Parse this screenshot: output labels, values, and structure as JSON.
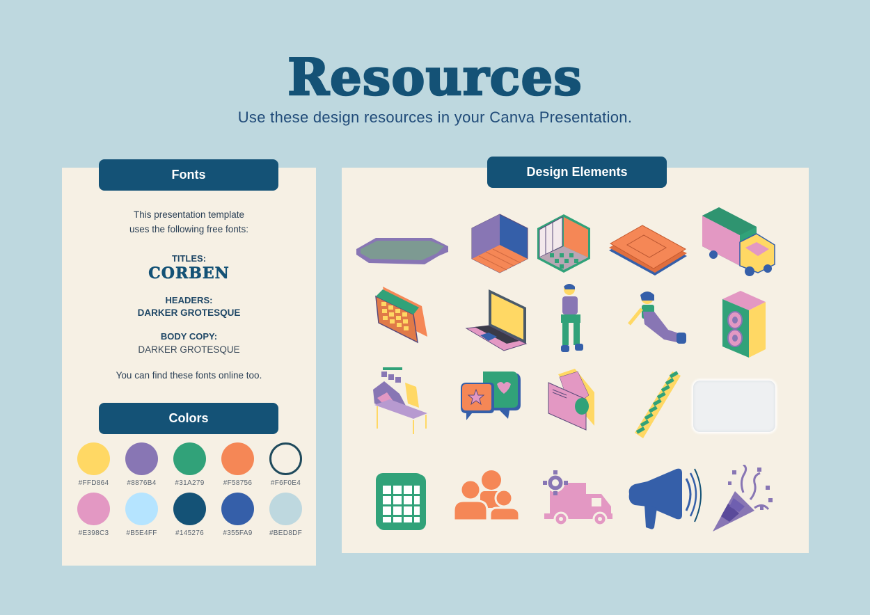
{
  "header": {
    "title": "Resources",
    "subtitle": "Use these design resources in your Canva Presentation."
  },
  "fonts_panel": {
    "heading": "Fonts",
    "intro_line1": "This presentation template",
    "intro_line2": "uses the following free fonts:",
    "titles_label": "TITLES:",
    "titles_font": "CORBEN",
    "headers_label": "HEADERS:",
    "headers_font": "DARKER GROTESQUE",
    "body_label": "BODY COPY:",
    "body_font": "DARKER GROTESQUE",
    "footer": "You can find these fonts online too."
  },
  "colors_panel": {
    "heading": "Colors",
    "swatches": [
      {
        "hex": "#FFD864",
        "label": "#FFD864"
      },
      {
        "hex": "#8876B4",
        "label": "#8876B4"
      },
      {
        "hex": "#31A279",
        "label": "#31A279"
      },
      {
        "hex": "#F58756",
        "label": "#F58756"
      },
      {
        "hex": "#F6F0E4",
        "label": "#F6F0E4"
      },
      {
        "hex": "#E398C3",
        "label": "#E398C3"
      },
      {
        "hex": "#B5E4FF",
        "label": "#B5E4FF"
      },
      {
        "hex": "#145276",
        "label": "#145276"
      },
      {
        "hex": "#355FA9",
        "label": "#355FA9"
      },
      {
        "hex": "#BED8DF",
        "label": "#BED8DF"
      }
    ]
  },
  "elements_panel": {
    "heading": "Design Elements",
    "items": [
      "octagon-platform-icon",
      "isometric-room-wood-icon",
      "isometric-room-tiles-icon",
      "blueprint-papers-icon",
      "food-truck-icon",
      "desk-calendar-icon",
      "laptop-icon",
      "standing-person-icon",
      "sitting-person-icon",
      "speaker-icon",
      "workstation-desk-icon",
      "chat-bubbles-icon",
      "envelope-letter-icon",
      "staircase-icon",
      "blank-frame-icon",
      "calendar-grid-icon",
      "team-people-icon",
      "delivery-truck-icon",
      "megaphone-icon",
      "party-popper-icon"
    ]
  }
}
